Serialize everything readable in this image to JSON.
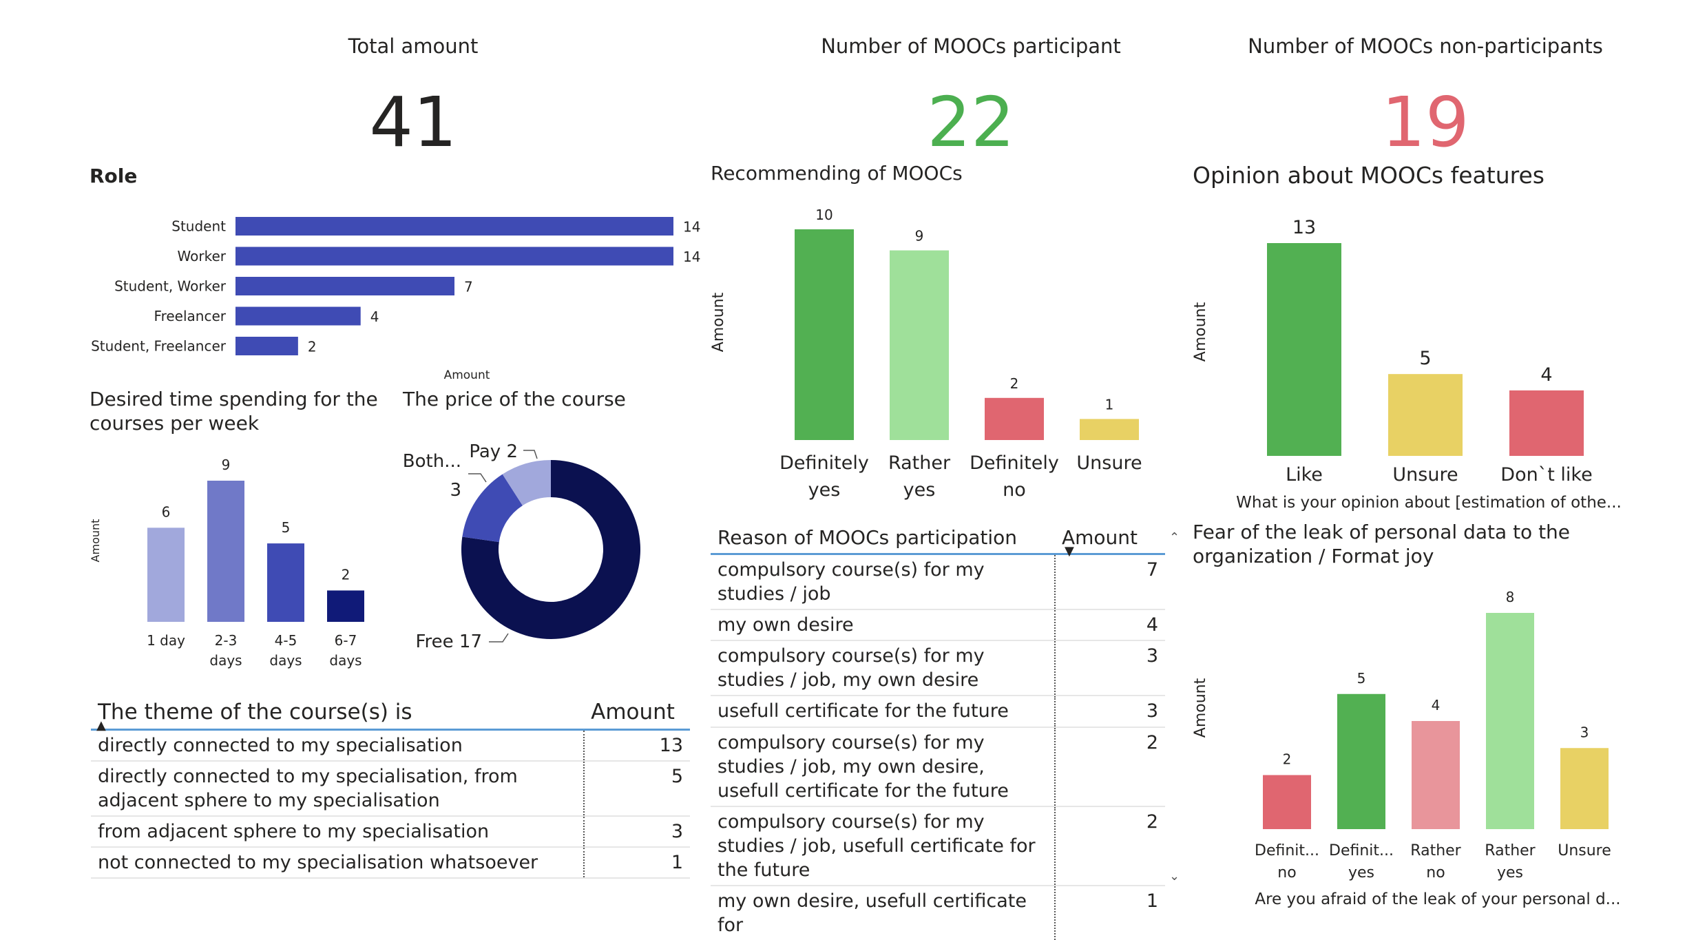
{
  "kpis": {
    "total": {
      "title": "Total amount",
      "value": "41",
      "color": "#252423"
    },
    "participants": {
      "title": "Number of MOOCs participant",
      "value": "22",
      "color": "#4caf50"
    },
    "non_participants": {
      "title": "Number of MOOCs non-participants",
      "value": "19",
      "color": "#e06670"
    }
  },
  "theme_table": {
    "headers": [
      "The theme of the course(s) is",
      "Amount"
    ],
    "rows": [
      [
        "directly connected to my specialisation",
        "13"
      ],
      [
        "directly connected to my specialisation, from adjacent sphere to my specialisation",
        "5"
      ],
      [
        "from adjacent sphere to my specialisation",
        "3"
      ],
      [
        "not connected to my specialisation whatsoever",
        "1"
      ]
    ]
  },
  "reason_table": {
    "headers": [
      "Reason of MOOCs participation",
      "Amount"
    ],
    "rows": [
      [
        "compulsory course(s) for my studies / job",
        "7"
      ],
      [
        "my own desire",
        "4"
      ],
      [
        "compulsory course(s) for my studies / job, my own desire",
        "3"
      ],
      [
        "usefull certificate for the future",
        "3"
      ],
      [
        "compulsory course(s) for my studies / job, my own desire, usefull certificate for the future",
        "2"
      ],
      [
        "compulsory course(s) for my studies / job, usefull certificate for the future",
        "2"
      ],
      [
        "my own desire, usefull certificate for",
        "1"
      ]
    ]
  },
  "chart_data": [
    {
      "id": "role",
      "type": "bar",
      "orientation": "horizontal",
      "title": "Role",
      "xlabel": "Amount",
      "categories": [
        "Student",
        "Worker",
        "Student, Worker",
        "Freelancer",
        "Student, Freelancer"
      ],
      "values": [
        14,
        14,
        7,
        4,
        2
      ],
      "colors": [
        "#3f4bb4",
        "#3f4bb4",
        "#3f4bb4",
        "#3f4bb4",
        "#3f4bb4"
      ],
      "xlim": [
        0,
        14
      ]
    },
    {
      "id": "time",
      "type": "bar",
      "title": "Desired time spending for the courses per week",
      "ylabel": "Amount",
      "categories": [
        [
          "1 day"
        ],
        [
          "2-3",
          "days"
        ],
        [
          "4-5",
          "days"
        ],
        [
          "6-7",
          "days"
        ]
      ],
      "values": [
        6,
        9,
        5,
        2
      ],
      "colors": [
        "#a1a8dc",
        "#7079c8",
        "#3f4bb4",
        "#101a78"
      ],
      "ylim": [
        0,
        9
      ]
    },
    {
      "id": "price",
      "type": "pie",
      "title": "The price of the course",
      "slices": [
        {
          "label": "Free",
          "value": 17,
          "color": "#0b1150",
          "text": "Free 17"
        },
        {
          "label": "Both...",
          "value": 3,
          "color": "#3f4bb4",
          "text": "Both..."
        },
        {
          "label": "Pay",
          "value": 2,
          "color": "#a1a8dc",
          "text": "Pay 2"
        }
      ],
      "extra_labels": [
        "3"
      ]
    },
    {
      "id": "recommend",
      "type": "bar",
      "title": "Recommending of MOOCs",
      "ylabel": "Amount",
      "categories": [
        [
          "Definitely",
          "yes"
        ],
        [
          "Rather",
          "yes"
        ],
        [
          "Definitely",
          "no"
        ],
        [
          "Unsure"
        ]
      ],
      "values": [
        10,
        9,
        2,
        1
      ],
      "colors": [
        "#52b052",
        "#9fe09a",
        "#e06670",
        "#e8d164"
      ],
      "ylim": [
        0,
        10
      ]
    },
    {
      "id": "opinion",
      "type": "bar",
      "title": "Opinion about MOOCs features",
      "ylabel": "Amount",
      "xlabel": "What is your opinion about [estimation of othe...",
      "categories": [
        [
          "Like"
        ],
        [
          "Unsure"
        ],
        [
          "Don`t like"
        ]
      ],
      "values": [
        13,
        5,
        4
      ],
      "colors": [
        "#52b052",
        "#e8d164",
        "#e06670"
      ],
      "ylim": [
        0,
        13
      ]
    },
    {
      "id": "fear",
      "type": "bar",
      "title": "Fear of the leak of personal data to the organization / Format joy",
      "ylabel": "Amount",
      "xlabel": "Are you afraid of the leak of your personal d...",
      "categories": [
        [
          "Definit...",
          "no"
        ],
        [
          "Definit...",
          "yes"
        ],
        [
          "Rather",
          "no"
        ],
        [
          "Rather",
          "yes"
        ],
        [
          "Unsure"
        ]
      ],
      "values": [
        2,
        5,
        4,
        8,
        3
      ],
      "colors": [
        "#e06670",
        "#52b052",
        "#e8959b",
        "#9fe09a",
        "#e8d164"
      ],
      "ylim": [
        0,
        8
      ]
    }
  ]
}
